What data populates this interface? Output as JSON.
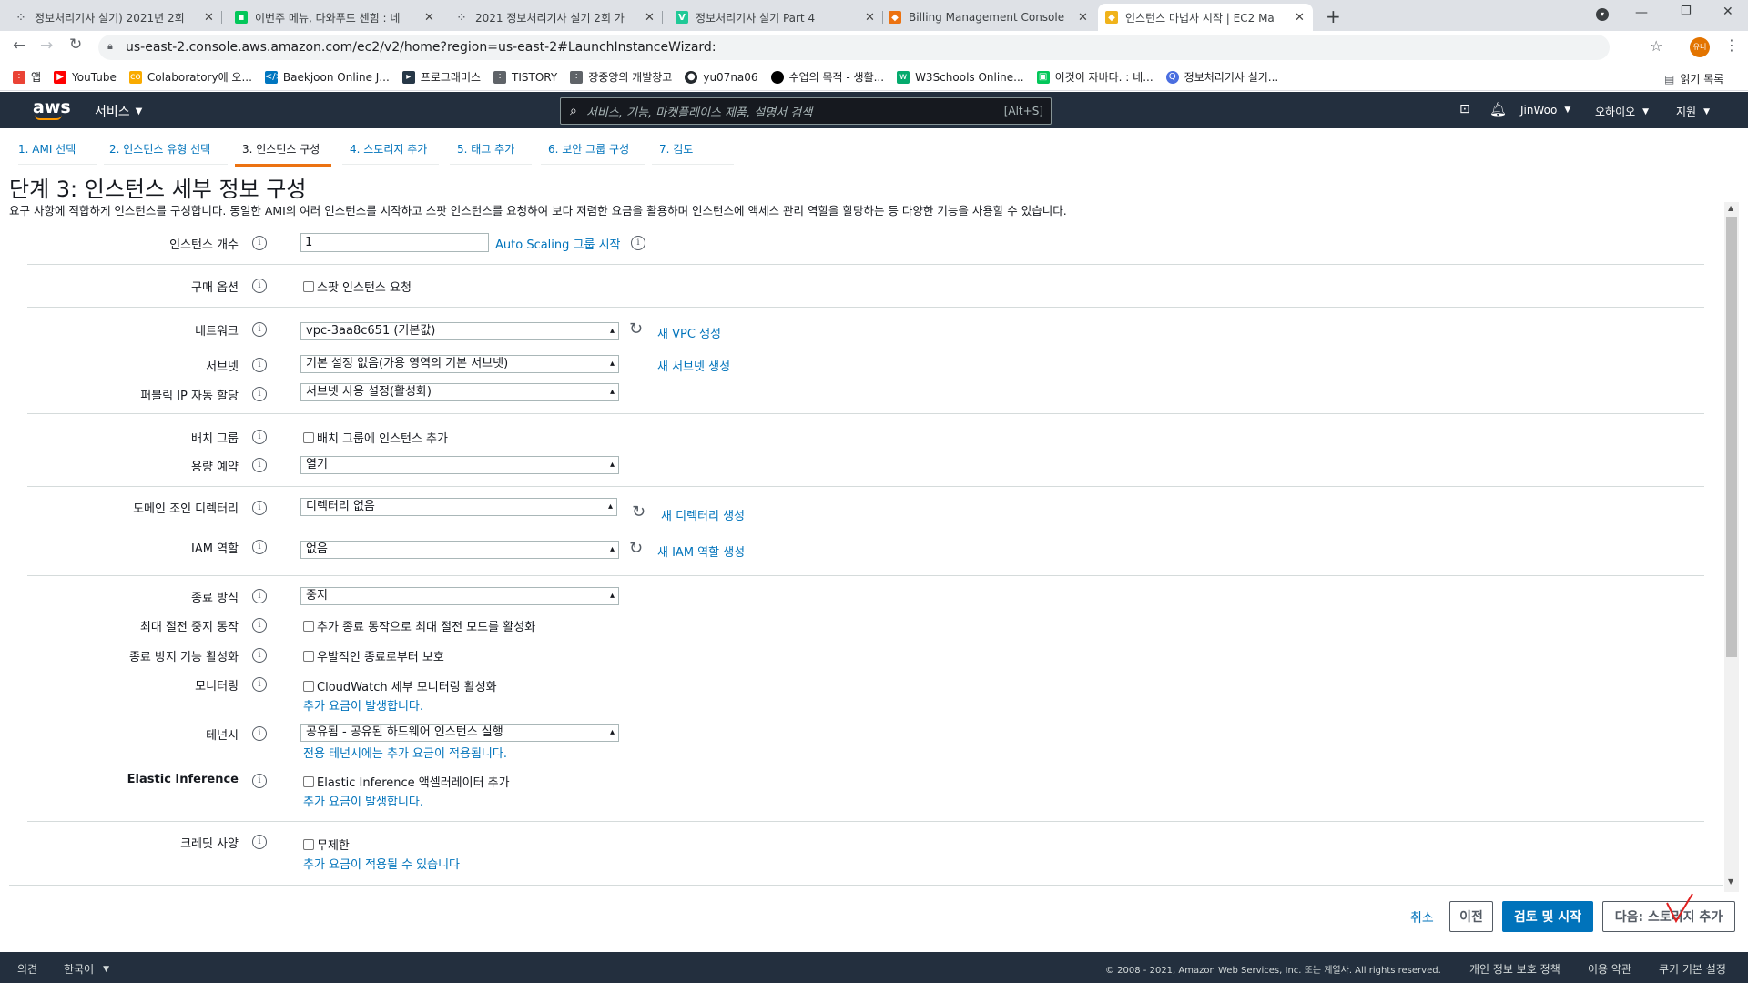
{
  "browser": {
    "tabs": [
      {
        "title": "정보처리기사 실기) 2021년 2회",
        "color": "#5f6368",
        "icon": "grid-favicon"
      },
      {
        "title": "이번주 메뉴, 다와푸드 센힘 : 네",
        "color": "#03c75a",
        "icon": "chat-favicon"
      },
      {
        "title": "2021 정보처리기사 실기 2회 가",
        "color": "#5f6368",
        "icon": "grid-favicon"
      },
      {
        "title": "정보처리기사 실기 Part 4",
        "color": "#20c997",
        "icon": "v-favicon"
      },
      {
        "title": "Billing Management Console",
        "color": "#ec7211",
        "icon": "aws-cube-favicon"
      },
      {
        "title": "인스턴스 마법사 시작 | EC2 Ma",
        "color": "#f0b31b",
        "icon": "aws-cube-favicon"
      }
    ],
    "url": "us-east-2.console.aws.amazon.com/ec2/v2/home?region=us-east-2#LaunchInstanceWizard:",
    "profile_initials": "유니",
    "bookmarks": [
      {
        "label": "앱",
        "color": "#ea4335"
      },
      {
        "label": "YouTube",
        "color": "#ff0000"
      },
      {
        "label": "Colaboratory에 오...",
        "color": "#f9ab00"
      },
      {
        "label": "Baekjoon Online J...",
        "color": "#0076c0"
      },
      {
        "label": "프로그래머스",
        "color": "#263747"
      },
      {
        "label": "TISTORY",
        "color": "#5f6368"
      },
      {
        "label": "장중앙의 개발창고",
        "color": "#5f6368"
      },
      {
        "label": "yu07na06",
        "color": "#24292e"
      },
      {
        "label": "수업의 목적 - 생활...",
        "color": "#000000"
      },
      {
        "label": "W3Schools Online...",
        "color": "#04aa6d"
      },
      {
        "label": "이것이 자바다. : 네...",
        "color": "#03c75a"
      },
      {
        "label": "정보처리기사 실기...",
        "color": "#4a6ee0"
      }
    ],
    "reading_list": "읽기 목록"
  },
  "aws_header": {
    "logo": "aws",
    "services": "서비스",
    "search_placeholder": "서비스, 기능, 마켓플레이스 제품, 설명서 검색",
    "search_shortcut": "[Alt+S]",
    "user": "JinWoo",
    "region": "오하이오",
    "support": "지원"
  },
  "steps": [
    "1. AMI 선택",
    "2. 인스턴스 유형 선택",
    "3. 인스턴스 구성",
    "4. 스토리지 추가",
    "5. 태그 추가",
    "6. 보안 그룹 구성",
    "7. 검토"
  ],
  "page": {
    "title": "단계 3: 인스턴스 세부 정보 구성",
    "description": "요구 사항에 적합하게 인스턴스를 구성합니다. 동일한 AMI의 여러 인스턴스를 시작하고 스팟 인스턴스를 요청하여 보다 저렴한 요금을 활용하며 인스턴스에 액세스 관리 역할을 할당하는 등 다양한 기능을 사용할 수 있습니다."
  },
  "form": {
    "instance_count": {
      "label": "인스턴스 개수",
      "value": "1",
      "link": "Auto Scaling 그룹 시작"
    },
    "purchase": {
      "label": "구매 옵션",
      "checkbox": "스팟 인스턴스 요청"
    },
    "network": {
      "label": "네트워크",
      "value": "vpc-3aa8c651 (기본값)",
      "link": "새 VPC 생성"
    },
    "subnet": {
      "label": "서브넷",
      "value": "기본 설정 없음(가용 영역의 기본 서브넷)",
      "link": "새 서브넷 생성"
    },
    "public_ip": {
      "label": "퍼블릭 IP 자동 할당",
      "value": "서브넷 사용 설정(활성화)"
    },
    "placement": {
      "label": "배치 그룹",
      "checkbox": "배치 그룹에 인스턴스 추가"
    },
    "capacity": {
      "label": "용량 예약",
      "value": "열기"
    },
    "domain": {
      "label": "도메인 조인 디렉터리",
      "value": "디렉터리 없음",
      "link": "새 디렉터리 생성"
    },
    "iam": {
      "label": "IAM 역할",
      "value": "없음",
      "link": "새 IAM 역할 생성"
    },
    "shutdown": {
      "label": "종료 방식",
      "value": "중지"
    },
    "hibernate": {
      "label": "최대 절전 중지 동작",
      "checkbox": "추가 종료 동작으로 최대 절전 모드를 활성화"
    },
    "termination": {
      "label": "종료 방지 기능 활성화",
      "checkbox": "우발적인 종료로부터 보호"
    },
    "monitoring": {
      "label": "모니터링",
      "checkbox": "CloudWatch 세부 모니터링 활성화",
      "note": "추가 요금이 발생합니다."
    },
    "tenancy": {
      "label": "테넌시",
      "value": "공유됨 - 공유된 하드웨어 인스턴스 실행",
      "note": "전용 테넌시에는 추가 요금이 적용됩니다."
    },
    "elastic": {
      "label": "Elastic Inference",
      "checkbox": "Elastic Inference 액셀러레이터 추가",
      "note": "추가 요금이 발생합니다."
    },
    "credit": {
      "label": "크레딧 사양",
      "checkbox": "무제한",
      "note": "추가 요금이 적용될 수 있습니다"
    }
  },
  "actions": {
    "cancel": "취소",
    "previous": "이전",
    "review_launch": "검토 및 시작",
    "next": "다음: 스토리지 추가"
  },
  "footer": {
    "feedback": "의견",
    "language": "한국어",
    "copyright": "© 2008 - 2021, Amazon Web Services, Inc. 또는 계열사. All rights reserved.",
    "privacy": "개인 정보 보호 정책",
    "terms": "이용 약관",
    "cookies": "쿠키 기본 설정"
  },
  "colors": {
    "aws_navy": "#232f3e",
    "link_blue": "#0073bb",
    "primary_button": "#0073bb",
    "active_step": "#ec7211"
  }
}
